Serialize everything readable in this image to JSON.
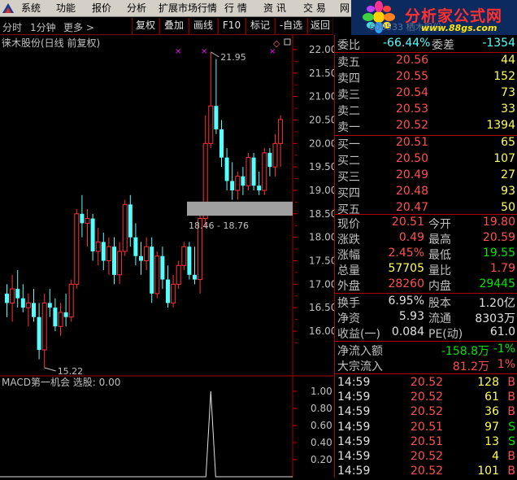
{
  "menubar": {
    "items": [
      "系统",
      "功能",
      "报价",
      "分析",
      "扩展市场行情",
      "行 情",
      "资 讯",
      "交 易",
      "网"
    ]
  },
  "banner": {
    "title": "分析家公式网",
    "url": "www.88gs.com",
    "sub": "600533 栖木股份"
  },
  "toolbar": {
    "left": [
      "分时",
      "1分钟",
      "更多 >"
    ],
    "buttons": [
      "复权",
      "叠加",
      "画线",
      "F10",
      "标记",
      "-自选",
      "返回"
    ]
  },
  "chart": {
    "title": "徕木股份(日线 前复权)",
    "price_axis": [
      "22.00",
      "21.50",
      "21.00",
      "20.50",
      "20.00",
      "19.50",
      "19.00",
      "18.50",
      "18.00",
      "17.50",
      "17.00",
      "16.50",
      "16.00"
    ],
    "high_label": "21.95",
    "low_label": "15.22",
    "range_label": "18.46 - 18.76",
    "indicator_title": "MACD第一机会 选股: 0.00",
    "indicator_axis": [
      "1.00",
      "0.80",
      "0.60",
      "0.40",
      "0.20"
    ],
    "colors": {
      "up": "#ff3232",
      "down": "#54ffff",
      "axis": "#b00000",
      "marker": "#ff00ff"
    }
  },
  "chart_data": {
    "type": "candlestick",
    "title": "徕木股份(日线 前复权)",
    "ylim": [
      15.0,
      22.2
    ],
    "high": 21.95,
    "low": 15.22,
    "range_box": [
      18.46,
      18.76
    ],
    "candles": [
      {
        "o": 16.8,
        "h": 17.0,
        "l": 16.3,
        "c": 16.6
      },
      {
        "o": 16.6,
        "h": 17.2,
        "l": 16.2,
        "c": 16.9
      },
      {
        "o": 16.9,
        "h": 17.3,
        "l": 16.5,
        "c": 16.7
      },
      {
        "o": 16.7,
        "h": 17.0,
        "l": 16.4,
        "c": 16.5
      },
      {
        "o": 16.5,
        "h": 16.8,
        "l": 16.1,
        "c": 16.6
      },
      {
        "o": 16.6,
        "h": 16.9,
        "l": 16.2,
        "c": 16.3
      },
      {
        "o": 16.3,
        "h": 16.6,
        "l": 15.4,
        "c": 15.6
      },
      {
        "o": 15.6,
        "h": 16.8,
        "l": 15.22,
        "c": 16.6
      },
      {
        "o": 16.6,
        "h": 16.9,
        "l": 16.3,
        "c": 16.5
      },
      {
        "o": 16.5,
        "h": 16.7,
        "l": 16.0,
        "c": 16.1
      },
      {
        "o": 16.1,
        "h": 16.6,
        "l": 15.9,
        "c": 16.4
      },
      {
        "o": 16.4,
        "h": 16.8,
        "l": 16.1,
        "c": 16.3
      },
      {
        "o": 16.3,
        "h": 17.1,
        "l": 16.2,
        "c": 17.0
      },
      {
        "o": 17.0,
        "h": 18.6,
        "l": 16.9,
        "c": 18.5
      },
      {
        "o": 18.5,
        "h": 18.9,
        "l": 18.0,
        "c": 18.3
      },
      {
        "o": 18.3,
        "h": 18.6,
        "l": 17.8,
        "c": 18.4
      },
      {
        "o": 18.4,
        "h": 18.5,
        "l": 17.5,
        "c": 17.7
      },
      {
        "o": 17.7,
        "h": 18.2,
        "l": 17.4,
        "c": 17.9
      },
      {
        "o": 17.9,
        "h": 18.1,
        "l": 17.3,
        "c": 17.5
      },
      {
        "o": 17.5,
        "h": 18.0,
        "l": 17.2,
        "c": 17.8
      },
      {
        "o": 17.8,
        "h": 18.0,
        "l": 17.0,
        "c": 17.2
      },
      {
        "o": 17.2,
        "h": 17.9,
        "l": 17.0,
        "c": 17.7
      },
      {
        "o": 17.7,
        "h": 18.8,
        "l": 17.6,
        "c": 18.7
      },
      {
        "o": 18.7,
        "h": 18.9,
        "l": 17.8,
        "c": 18.0
      },
      {
        "o": 18.0,
        "h": 18.3,
        "l": 17.4,
        "c": 17.6
      },
      {
        "o": 17.6,
        "h": 17.9,
        "l": 17.2,
        "c": 17.5
      },
      {
        "o": 17.5,
        "h": 18.0,
        "l": 17.3,
        "c": 17.8
      },
      {
        "o": 17.8,
        "h": 18.0,
        "l": 16.6,
        "c": 16.8
      },
      {
        "o": 16.8,
        "h": 17.7,
        "l": 16.7,
        "c": 17.6
      },
      {
        "o": 17.6,
        "h": 17.8,
        "l": 16.9,
        "c": 17.1
      },
      {
        "o": 17.1,
        "h": 17.4,
        "l": 16.5,
        "c": 16.6
      },
      {
        "o": 16.6,
        "h": 17.2,
        "l": 16.5,
        "c": 17.0
      },
      {
        "o": 17.0,
        "h": 17.5,
        "l": 16.9,
        "c": 17.4
      },
      {
        "o": 17.4,
        "h": 17.9,
        "l": 17.3,
        "c": 17.8
      },
      {
        "o": 17.8,
        "h": 17.9,
        "l": 17.1,
        "c": 17.2
      },
      {
        "o": 17.2,
        "h": 17.8,
        "l": 17.0,
        "c": 17.1
      },
      {
        "o": 17.1,
        "h": 18.5,
        "l": 16.8,
        "c": 18.4
      },
      {
        "o": 18.4,
        "h": 20.6,
        "l": 18.2,
        "c": 20.0
      },
      {
        "o": 20.0,
        "h": 21.95,
        "l": 19.9,
        "c": 20.8
      },
      {
        "o": 20.8,
        "h": 21.8,
        "l": 20.2,
        "c": 20.3
      },
      {
        "o": 20.3,
        "h": 20.5,
        "l": 19.5,
        "c": 19.7
      },
      {
        "o": 19.7,
        "h": 19.9,
        "l": 19.0,
        "c": 19.2
      },
      {
        "o": 19.2,
        "h": 19.6,
        "l": 18.8,
        "c": 19.0
      },
      {
        "o": 19.0,
        "h": 19.4,
        "l": 18.8,
        "c": 19.3
      },
      {
        "o": 19.3,
        "h": 19.5,
        "l": 18.9,
        "c": 19.1
      },
      {
        "o": 19.1,
        "h": 19.8,
        "l": 19.0,
        "c": 19.7
      },
      {
        "o": 19.7,
        "h": 19.8,
        "l": 19.0,
        "c": 19.1
      },
      {
        "o": 19.1,
        "h": 19.4,
        "l": 18.9,
        "c": 19.0
      },
      {
        "o": 19.0,
        "h": 19.9,
        "l": 18.9,
        "c": 19.8
      },
      {
        "o": 19.8,
        "h": 19.9,
        "l": 19.3,
        "c": 19.5
      },
      {
        "o": 19.5,
        "h": 20.2,
        "l": 19.3,
        "c": 20.0
      },
      {
        "o": 20.0,
        "h": 20.6,
        "l": 19.5,
        "c": 20.51
      }
    ],
    "indicator": {
      "name": "MACD第一机会 选股",
      "value": 0.0,
      "ylim": [
        0,
        1.05
      ],
      "spike_index": 38,
      "spike_value": 1.0
    }
  },
  "quote": {
    "weibi": {
      "label": "委比",
      "value": "-66.44%",
      "label2": "委差",
      "value2": "-1354"
    },
    "asks": [
      {
        "label": "卖五",
        "price": "20.56",
        "vol": "44"
      },
      {
        "label": "卖四",
        "price": "20.55",
        "vol": "152"
      },
      {
        "label": "卖三",
        "price": "20.54",
        "vol": "73"
      },
      {
        "label": "卖二",
        "price": "20.53",
        "vol": "33"
      },
      {
        "label": "卖一",
        "price": "20.52",
        "vol": "1394"
      }
    ],
    "bids": [
      {
        "label": "买一",
        "price": "20.51",
        "vol": "65"
      },
      {
        "label": "买二",
        "price": "20.50",
        "vol": "107"
      },
      {
        "label": "买三",
        "price": "20.49",
        "vol": "27"
      },
      {
        "label": "买四",
        "price": "20.48",
        "vol": "93"
      },
      {
        "label": "买五",
        "price": "20.47",
        "vol": "50"
      }
    ],
    "stats": [
      {
        "l1": "现价",
        "v1": "20.51",
        "l2": "今开",
        "v2": "19.80"
      },
      {
        "l1": "涨跌",
        "v1": "0.49",
        "l2": "最高",
        "v2": "20.59"
      },
      {
        "l1": "涨幅",
        "v1": "2.45%",
        "l2": "最低",
        "v2": "19.55"
      },
      {
        "l1": "总量",
        "v1": "57705",
        "l2": "量比",
        "v2": "1.79"
      },
      {
        "l1": "外盘",
        "v1": "28260",
        "l2": "内盘",
        "v2": "29445"
      }
    ],
    "finance": [
      {
        "l1": "换手",
        "v1": "6.95%",
        "l2": "股本",
        "v2": "1.20亿"
      },
      {
        "l1": "净资",
        "v1": "5.93",
        "l2": "流通",
        "v2": "8303万"
      },
      {
        "l1": "收益(一)",
        "v1": "0.084",
        "l2": "PE(动)",
        "v2": "61.0"
      }
    ],
    "flows": [
      {
        "label": "净流入额",
        "value": "-158.8万",
        "pct": "-1%"
      },
      {
        "label": "大宗流入",
        "value": "81.2万",
        "pct": "1%"
      }
    ],
    "ticks": [
      {
        "time": "14:59",
        "price": "20.52",
        "vol": "128",
        "side": "B"
      },
      {
        "time": "14:59",
        "price": "20.52",
        "vol": "61",
        "side": "B"
      },
      {
        "time": "14:59",
        "price": "20.52",
        "vol": "36",
        "side": "B"
      },
      {
        "time": "14:59",
        "price": "20.51",
        "vol": "97",
        "side": "S"
      },
      {
        "time": "14:59",
        "price": "20.51",
        "vol": "13",
        "side": "S"
      },
      {
        "time": "14:59",
        "price": "20.52",
        "vol": "4",
        "side": "B"
      },
      {
        "time": "14:59",
        "price": "20.52",
        "vol": "101",
        "side": "B"
      }
    ]
  }
}
